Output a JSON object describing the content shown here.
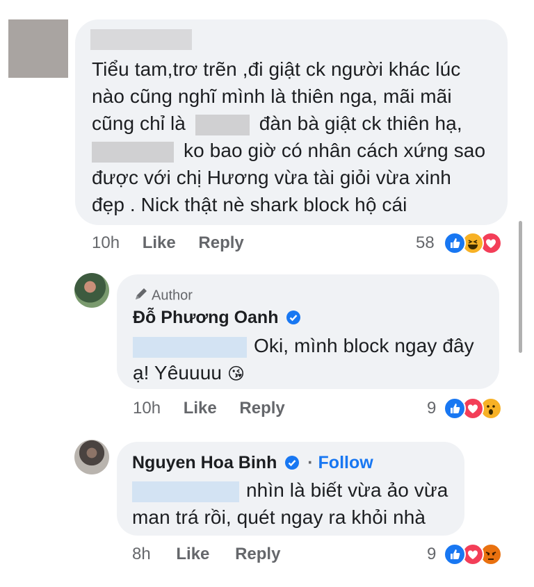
{
  "comments": [
    {
      "text_lines": [
        "Tiểu tam,trơ trẽn ,đi giật ck người khác lúc",
        "nào cũng nghĩ mình là thiên nga, mãi mãi",
        "cũng chỉ là",
        "đàn bà giật ck thiên hạ,",
        "ko bao giờ có nhân cách xứng sao",
        "được với chị Hương vừa tài giỏi vừa xinh",
        "đẹp . Nick thật nè shark block hộ cái"
      ],
      "time": "10h",
      "like": "Like",
      "reply": "Reply",
      "reaction_count": "58",
      "reactions": [
        "like-icon",
        "haha-icon",
        "love-icon"
      ]
    },
    {
      "author_tag": "Author",
      "name": "Đỗ Phương Oanh",
      "verified": true,
      "text_lines": [
        "Oki, mình block ngay đây",
        "ạ! Yêuuuu"
      ],
      "emoji": "😘",
      "time": "10h",
      "like": "Like",
      "reply": "Reply",
      "reaction_count": "9",
      "reactions": [
        "like-icon",
        "love-icon",
        "wow-icon"
      ]
    },
    {
      "name": "Nguyen Hoa Binh",
      "verified": true,
      "follow": "Follow",
      "separator": "·",
      "text_lines": [
        "nhìn là biết vừa ảo vừa",
        "man trá rồi, quét ngay ra khỏi nhà"
      ],
      "time": "8h",
      "like": "Like",
      "reply": "Reply",
      "reaction_count": "9",
      "reactions": [
        "like-icon",
        "love-icon",
        "angry-icon"
      ]
    }
  ],
  "colors": {
    "bubble": "#f0f2f5",
    "link_blue": "#1877f2",
    "meta_grey": "#65676b",
    "text": "#1c1e21"
  }
}
